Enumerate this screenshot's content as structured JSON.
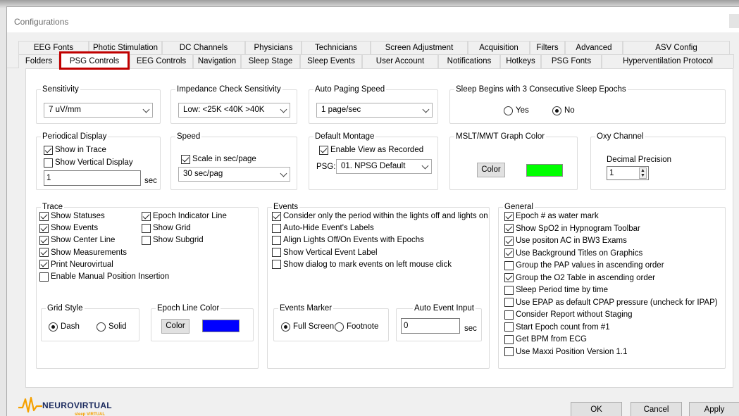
{
  "window": {
    "title": "Configurations"
  },
  "tabs_row1": [
    "EEG Fonts",
    "Photic Stimulation",
    "DC Channels",
    "Physicians",
    "Technicians",
    "Screen Adjustment",
    "Acquisition",
    "Filters",
    "Advanced",
    "ASV Config"
  ],
  "tabs_row2": [
    "Folders",
    "PSG Controls",
    "EEG Controls",
    "Navigation",
    "Sleep Stage",
    "Sleep Events",
    "User Account",
    "Notifications",
    "Hotkeys",
    "PSG Fonts",
    "Hyperventilation Protocol"
  ],
  "active_tab": "PSG Controls",
  "sensitivity": {
    "legend": "Sensitivity",
    "value": "7 uV/mm"
  },
  "impedance": {
    "legend": "Impedance Check Sensitivity",
    "value": "Low: <25K <40K >40K"
  },
  "auto_paging": {
    "legend": "Auto Paging Speed",
    "value": "1 page/sec"
  },
  "sleep_begins": {
    "legend": "Sleep Begins with 3 Consecutive Sleep Epochs",
    "yes": "Yes",
    "no": "No",
    "selected": "No"
  },
  "periodical": {
    "legend": "Periodical Display",
    "show_in_trace": "Show in Trace",
    "show_vertical": "Show Vertical Display",
    "value": "1",
    "unit": "sec"
  },
  "speed": {
    "legend": "Speed",
    "scale": "Scale in sec/page",
    "value": "30 sec/pag"
  },
  "montage": {
    "legend": "Default Montage",
    "enable_view": "Enable View as Recorded",
    "psg_label": "PSG:",
    "value": "01. NPSG Default"
  },
  "mslt": {
    "legend": "MSLT/MWT Graph Color",
    "button": "Color",
    "color": "#00ff00"
  },
  "oxy": {
    "legend": "Oxy Channel",
    "label": "Decimal Precision",
    "value": "1"
  },
  "trace": {
    "legend": "Trace",
    "items_left": [
      {
        "label": "Show Statuses",
        "checked": true
      },
      {
        "label": "Show Events",
        "checked": true
      },
      {
        "label": "Show Center Line",
        "checked": true
      },
      {
        "label": "Show Measurements",
        "checked": true
      },
      {
        "label": "Print Neurovirtual",
        "checked": true
      },
      {
        "label": "Enable Manual Position Insertion",
        "checked": false
      }
    ],
    "items_right": [
      {
        "label": "Epoch Indicator Line",
        "checked": true
      },
      {
        "label": "Show Grid",
        "checked": false
      },
      {
        "label": "Show Subgrid",
        "checked": false
      }
    ]
  },
  "grid_style": {
    "legend": "Grid Style",
    "dash": "Dash",
    "solid": "Solid",
    "selected": "Dash"
  },
  "epoch_color": {
    "legend": "Epoch Line Color",
    "button": "Color",
    "color": "#0000ff"
  },
  "events": {
    "legend": "Events",
    "items": [
      {
        "label": "Consider only the period within the lights off and lights on",
        "checked": true
      },
      {
        "label": "Auto-Hide Event's Labels",
        "checked": false
      },
      {
        "label": "Align Lights Off/On Events with Epochs",
        "checked": false
      },
      {
        "label": "Show Vertical Event Label",
        "checked": false
      },
      {
        "label": "Show dialog to mark events on left mouse click",
        "checked": false
      }
    ]
  },
  "events_marker": {
    "legend": "Events Marker",
    "full": "Full Screen",
    "foot": "Footnote",
    "selected": "Full Screen"
  },
  "auto_event": {
    "legend": "Auto Event Input",
    "value": "0",
    "unit": "sec"
  },
  "general": {
    "legend": "General",
    "items": [
      {
        "label": "Epoch # as water mark",
        "checked": true
      },
      {
        "label": "Show SpO2 in Hypnogram Toolbar",
        "checked": true
      },
      {
        "label": "Use positon AC in BW3 Exams",
        "checked": true
      },
      {
        "label": "Use Background Titles on Graphics",
        "checked": true
      },
      {
        "label": "Group the PAP values in ascending order",
        "checked": false
      },
      {
        "label": "Group the O2 Table in ascending order",
        "checked": true
      },
      {
        "label": "Sleep Period time by time",
        "checked": false
      },
      {
        "label": "Use EPAP as default CPAP pressure (uncheck for IPAP)",
        "checked": false
      },
      {
        "label": "Consider Report without Staging",
        "checked": false
      },
      {
        "label": "Start Epoch count from #1",
        "checked": false
      },
      {
        "label": "Get BPM from ECG",
        "checked": false
      },
      {
        "label": "Use Maxxi Position Version 1.1",
        "checked": false
      }
    ]
  },
  "footer": {
    "ok": "OK",
    "cancel": "Cancel",
    "apply": "Apply",
    "logo_text": "NEUROVIRTUAL",
    "logo_sub": "sleep VIRTUAL"
  },
  "colors": {
    "active_tab_border": "#c00000",
    "logo_orange": "#f5a000",
    "logo_navy": "#1b2a5e"
  }
}
